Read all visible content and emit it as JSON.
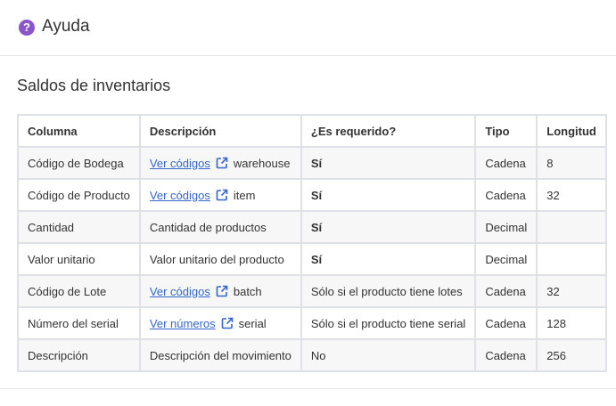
{
  "header": {
    "title": "Ayuda",
    "icon": "question-circle-icon"
  },
  "section": {
    "title": "Saldos de inventarios"
  },
  "colors": {
    "accent": "#8a56c9",
    "required": "#d6336c",
    "link": "#3366cc"
  },
  "table": {
    "headers": [
      "Columna",
      "Descripción",
      "¿Es requerido?",
      "Tipo",
      "Longitud"
    ],
    "rows": [
      {
        "column": "Código de Bodega",
        "desc_link": "Ver códigos",
        "desc_field": "warehouse",
        "desc_text": "",
        "required": "Sí",
        "required_flag": true,
        "type": "Cadena",
        "length": "8"
      },
      {
        "column": "Código de Producto",
        "desc_link": "Ver códigos",
        "desc_field": "item",
        "desc_text": "",
        "required": "Sí",
        "required_flag": true,
        "type": "Cadena",
        "length": "32"
      },
      {
        "column": "Cantidad",
        "desc_link": "",
        "desc_field": "",
        "desc_text": "Cantidad de productos",
        "required": "Sí",
        "required_flag": true,
        "type": "Decimal",
        "length": ""
      },
      {
        "column": "Valor unitario",
        "desc_link": "",
        "desc_field": "",
        "desc_text": "Valor unitario del producto",
        "required": "Sí",
        "required_flag": true,
        "type": "Decimal",
        "length": ""
      },
      {
        "column": "Código de Lote",
        "desc_link": "Ver códigos",
        "desc_field": "batch",
        "desc_text": "",
        "required": "Sólo si el producto tiene lotes",
        "required_flag": false,
        "type": "Cadena",
        "length": "32"
      },
      {
        "column": "Número del serial",
        "desc_link": "Ver números",
        "desc_field": "serial",
        "desc_text": "",
        "required": "Sólo si el producto tiene serial",
        "required_flag": false,
        "type": "Cadena",
        "length": "128"
      },
      {
        "column": "Descripción",
        "desc_link": "",
        "desc_field": "",
        "desc_text": "Descripción del movimiento",
        "required": "No",
        "required_flag": false,
        "type": "Cadena",
        "length": "256"
      }
    ]
  }
}
